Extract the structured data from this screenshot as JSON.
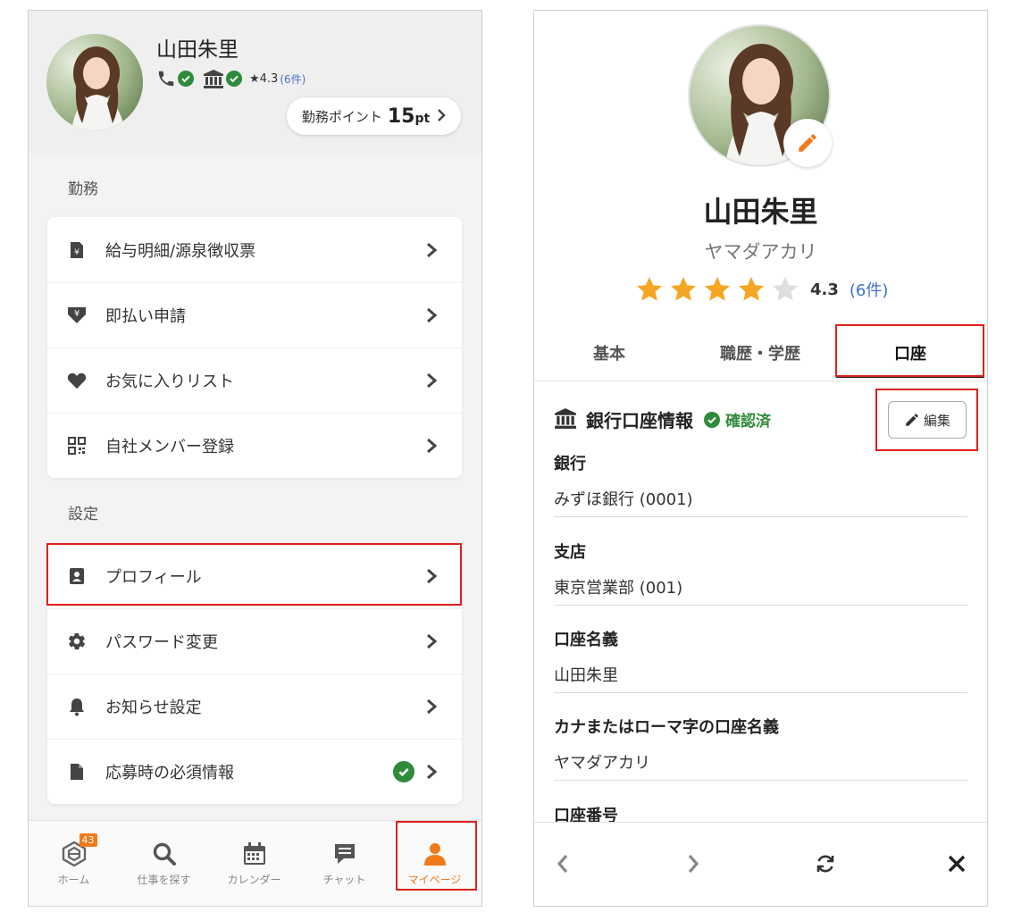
{
  "left": {
    "profile": {
      "name": "山田朱里",
      "rating": "4.3",
      "review_count": "(6件)",
      "points_label": "勤務ポイント",
      "points_value": "15",
      "points_unit": "pt"
    },
    "sections": {
      "work_title": "勤務",
      "settings_title": "設定"
    },
    "work_items": [
      {
        "label": "給与明細/源泉徴収票",
        "icon": "pay-slip-icon"
      },
      {
        "label": "即払い申請",
        "icon": "yen-download-icon"
      },
      {
        "label": "お気に入りリスト",
        "icon": "heart-icon"
      },
      {
        "label": "自社メンバー登録",
        "icon": "qr-code-icon"
      }
    ],
    "settings_items": [
      {
        "label": "プロフィール",
        "icon": "profile-card-icon"
      },
      {
        "label": "パスワード変更",
        "icon": "gear-icon"
      },
      {
        "label": "お知らせ設定",
        "icon": "bell-icon"
      },
      {
        "label": "応募時の必須情報",
        "icon": "document-icon"
      }
    ],
    "tabbar": [
      {
        "label": "ホーム",
        "badge": "43"
      },
      {
        "label": "仕事を探す"
      },
      {
        "label": "カレンダー"
      },
      {
        "label": "チャット"
      },
      {
        "label": "マイページ"
      }
    ]
  },
  "right": {
    "name": "山田朱里",
    "kana": "ヤマダアカリ",
    "rating": "4.3",
    "rating_value": 4,
    "review_count": "(6件)",
    "tabs": [
      "基本",
      "職歴・学歴",
      "口座"
    ],
    "active_tab": "口座",
    "bank_section": {
      "title": "銀行口座情報",
      "status": "確認済",
      "edit_label": "編集"
    },
    "fields": [
      {
        "label": "銀行",
        "value": "みずほ銀行 (0001)"
      },
      {
        "label": "支店",
        "value": "東京営業部 (001)"
      },
      {
        "label": "口座名義",
        "value": "山田朱里"
      },
      {
        "label": "カナまたはローマ字の口座名義",
        "value": "ヤマダアカリ"
      },
      {
        "label": "口座番号",
        "value": ""
      }
    ]
  },
  "colors": {
    "accent": "#f07a1a",
    "verified": "#2e8b3a",
    "link": "#3b6fd1",
    "highlight": "#e0201c",
    "star": "#f5a623"
  }
}
